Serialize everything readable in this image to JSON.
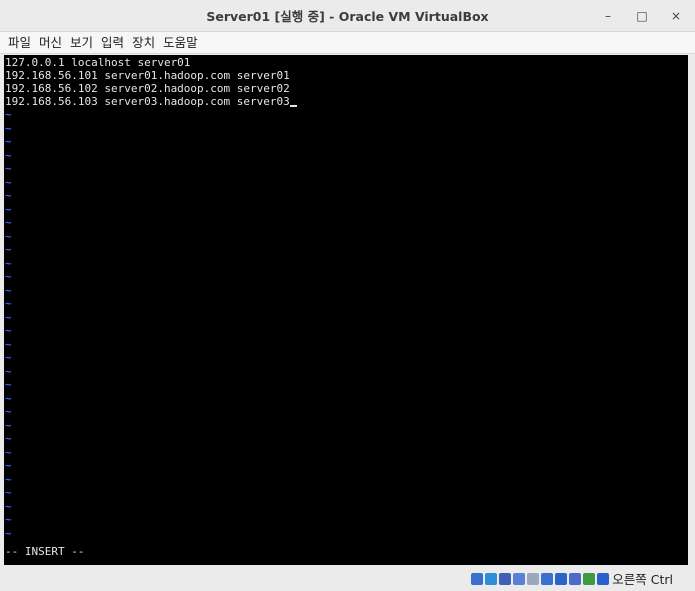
{
  "window": {
    "title": "Server01 [실행 중] - Oracle VM VirtualBox",
    "minimize": "–",
    "maximize": "□",
    "close": "×"
  },
  "menu": [
    "파일",
    "머신",
    "보기",
    "입력",
    "장치",
    "도움말"
  ],
  "terminal": {
    "lines": [
      "127.0.0.1 localhost server01",
      "192.168.56.101 server01.hadoop.com server01",
      "192.168.56.102 server02.hadoop.com server02",
      "192.168.56.103 server03.hadoop.com server03"
    ],
    "tilde": "~",
    "tilde_count": 32,
    "mode": "-- INSERT --"
  },
  "statusbar": {
    "icons": [
      {
        "name": "hard-disk-icon",
        "color": "#3b6fd0"
      },
      {
        "name": "optical-drive-icon",
        "color": "#2f8ed8"
      },
      {
        "name": "audio-icon",
        "color": "#3f5fb8"
      },
      {
        "name": "network-icon",
        "color": "#5a7fd8"
      },
      {
        "name": "usb-icon",
        "color": "#9aa7bd"
      },
      {
        "name": "shared-folders-icon",
        "color": "#3b6fd0"
      },
      {
        "name": "display-icon",
        "color": "#2c63c8"
      },
      {
        "name": "video-capture-icon",
        "color": "#4a6cc8"
      },
      {
        "name": "virtualization-icon",
        "color": "#3d9a3d"
      },
      {
        "name": "mouse-integration-icon",
        "color": "#2a5fd0"
      }
    ],
    "host_key": "오른쪽 Ctrl"
  }
}
